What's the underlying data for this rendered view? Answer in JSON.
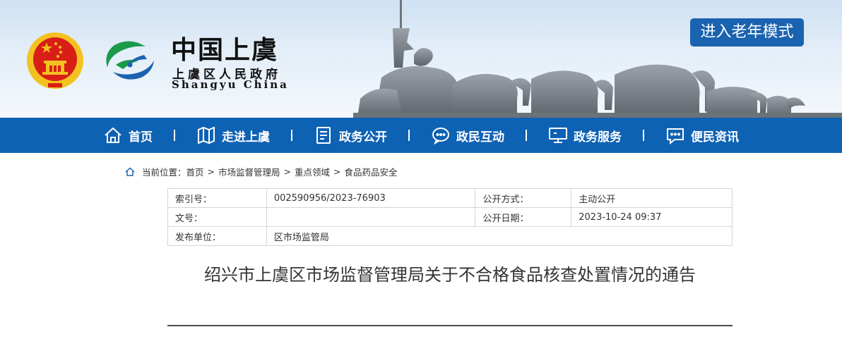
{
  "header": {
    "logo_cn": "中国上虞",
    "logo_subtitle": "上虞区人民政府",
    "logo_en": "Shangyu China",
    "elder_mode_label": "进入老年模式"
  },
  "nav": {
    "items": [
      {
        "label": "首页",
        "icon": "home-icon"
      },
      {
        "label": "走进上虞",
        "icon": "map-icon"
      },
      {
        "label": "政务公开",
        "icon": "document-icon"
      },
      {
        "label": "政民互动",
        "icon": "chat-icon"
      },
      {
        "label": "政务服务",
        "icon": "monitor-icon"
      },
      {
        "label": "便民资讯",
        "icon": "message-icon"
      }
    ]
  },
  "breadcrumb": {
    "prefix": "当前位置：",
    "items": [
      "首页",
      "市场监督管理局",
      "重点领域",
      "食品药品安全"
    ],
    "separator": ">"
  },
  "meta": {
    "index_label": "索引号：",
    "index_value": "002590956/2023-76903",
    "open_method_label": "公开方式：",
    "open_method_value": "主动公开",
    "doc_no_label": "文号：",
    "doc_no_value": "",
    "open_date_label": "公开日期：",
    "open_date_value": "2023-10-24 09:37",
    "publisher_label": "发布单位：",
    "publisher_value": "区市场监管局"
  },
  "article": {
    "title": "绍兴市上虞区市场监督管理局关于不合格食品核查处置情况的通告"
  },
  "colors": {
    "nav_bg": "#0e62b4",
    "elder_button_bg": "#1a63b0",
    "emblem_red": "#d91e18",
    "emblem_gold": "#f3c221",
    "logo_green": "#1b9a4a",
    "logo_blue": "#1a63b0"
  }
}
